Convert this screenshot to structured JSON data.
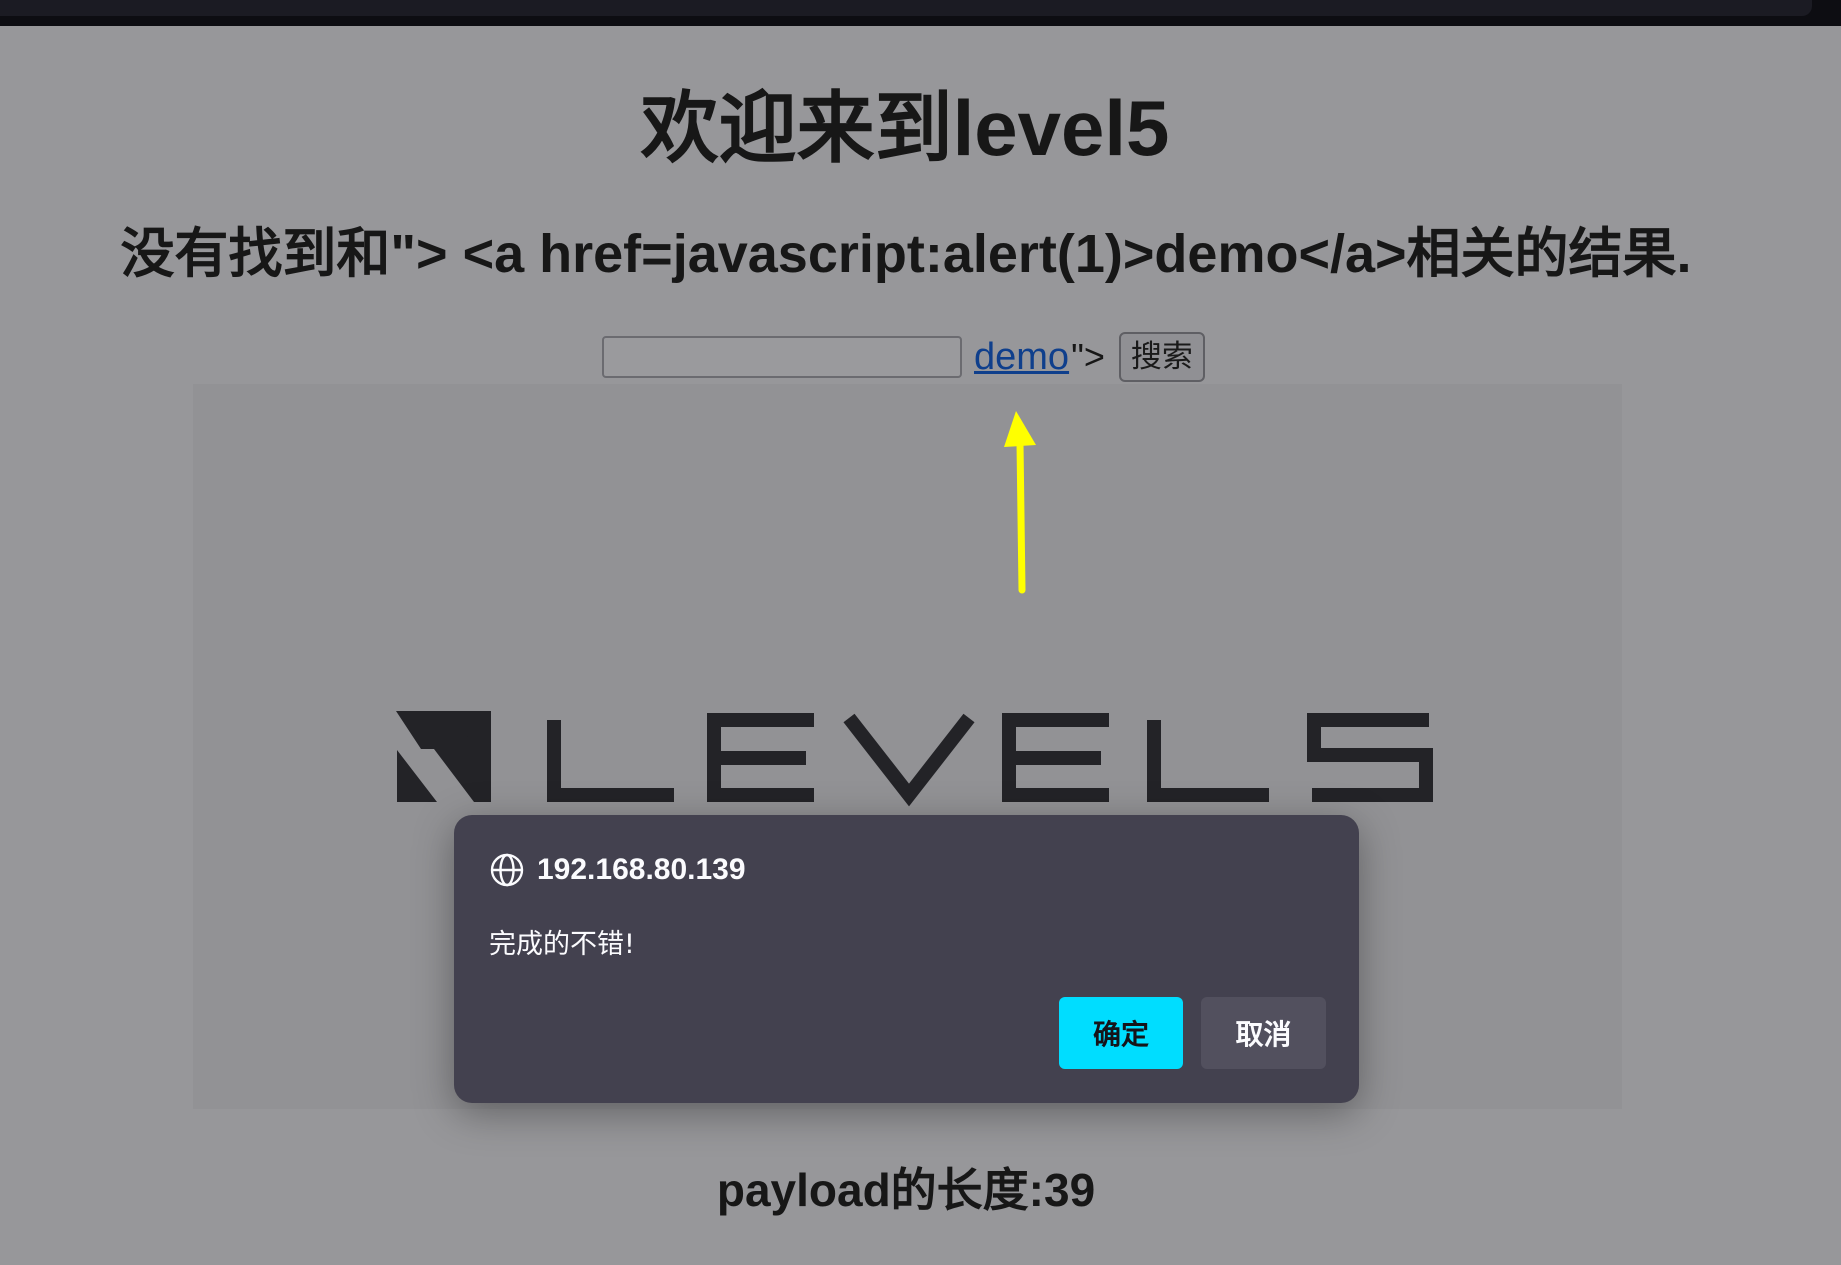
{
  "page": {
    "title": "欢迎来到level5",
    "result_prefix": "没有找到和\"> <a href=javascript:alert(1)>demo</a>相关的结果.",
    "payload_length": "payload的长度:39"
  },
  "search": {
    "input_value": "",
    "injected_link_text": "demo",
    "injected_tail": "\">",
    "button_label": "搜索"
  },
  "logo": {
    "text": "LEVEL5"
  },
  "dialog": {
    "origin": "192.168.80.139",
    "message": "完成的不错!",
    "ok_label": "确定",
    "cancel_label": "取消"
  },
  "colors": {
    "background": "#97979a",
    "dialog_bg": "#43414f",
    "ok_button": "#00ddff",
    "cancel_button": "#52505e",
    "arrow": "#ffff00",
    "link": "#0f3f8c"
  },
  "icons": {
    "dialog_origin": "globe-icon",
    "annotation": "arrow-up-icon"
  }
}
